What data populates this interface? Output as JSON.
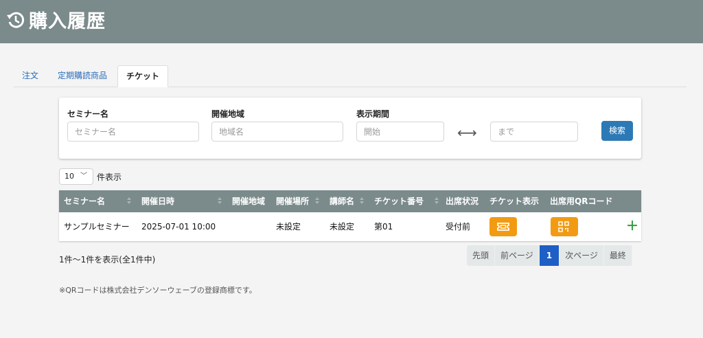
{
  "header": {
    "title": "購入履歴",
    "icon": "history-icon"
  },
  "tabs": [
    {
      "label": "注文",
      "active": false
    },
    {
      "label": "定期購読商品",
      "active": false
    },
    {
      "label": "チケット",
      "active": true
    }
  ],
  "filter": {
    "seminar_label": "セミナー名",
    "seminar_placeholder": "セミナー名",
    "region_label": "開催地域",
    "region_placeholder": "地域名",
    "period_label": "表示期間",
    "start_placeholder": "開始",
    "end_placeholder": "まで",
    "search_label": "検索"
  },
  "length": {
    "value": "10",
    "suffix": "件表示"
  },
  "table": {
    "headers": [
      "セミナー名",
      "開催日時",
      "開催地域",
      "開催場所",
      "講師名",
      "チケット番号",
      "出席状況",
      "チケット表示",
      "出席用QRコード"
    ],
    "rows": [
      {
        "seminar": "サンプルセミナー",
        "datetime": "2025-07-01 10:00",
        "region": "",
        "place": "未設定",
        "lecturer": "未設定",
        "ticket_no": "第01",
        "status": "受付前"
      }
    ]
  },
  "info": "1件～1件を表示(全1件中)",
  "pager": {
    "first": "先頭",
    "prev": "前ページ",
    "current": "1",
    "next": "次ページ",
    "last": "最終"
  },
  "note": "※QRコードは株式会社デンソーウェーブの登録商標です。",
  "colors": {
    "header_bg": "#7b8a8b",
    "accent": "#2c79b5",
    "ticket_button": "#f29b12",
    "page_active": "#1e5fc5",
    "plus": "#2e9c3a"
  }
}
